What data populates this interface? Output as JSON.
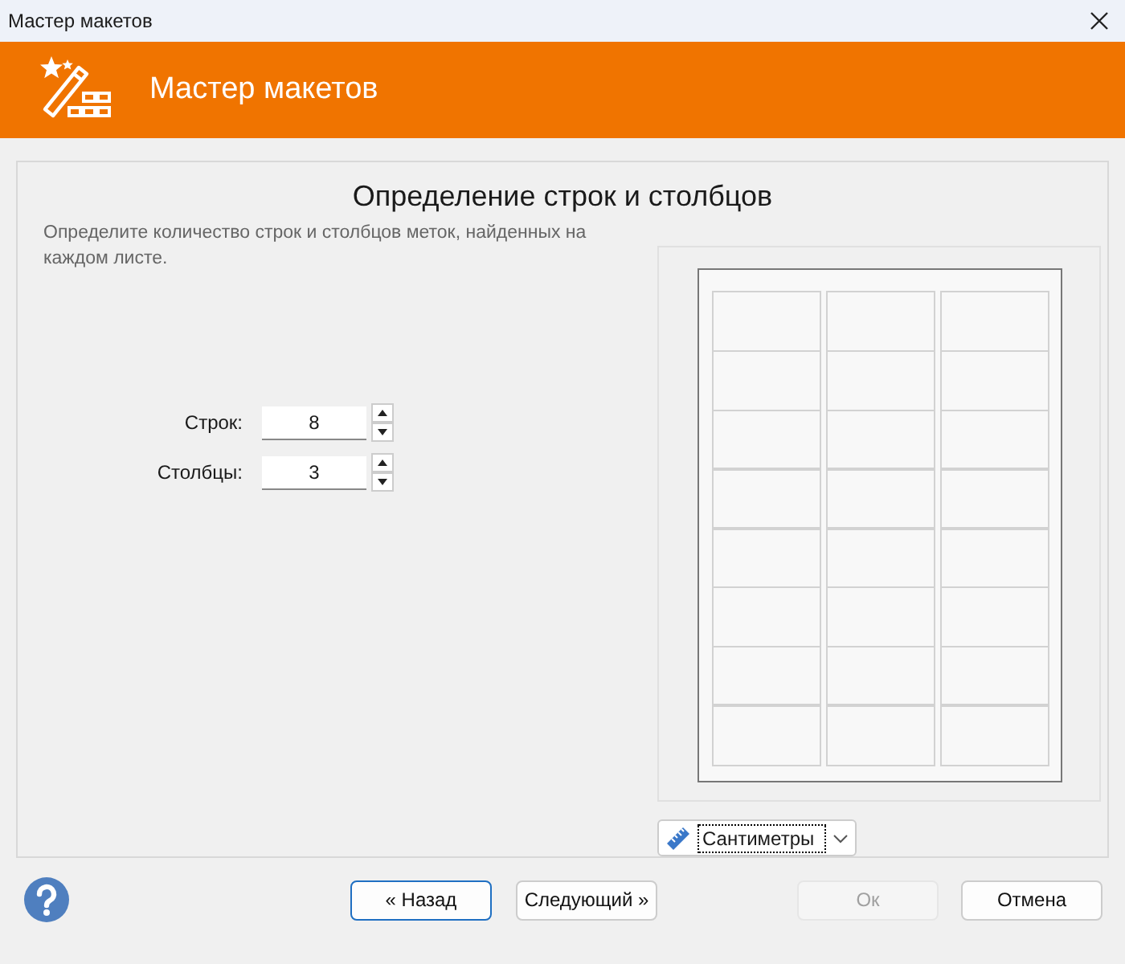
{
  "window": {
    "title": "Мастер макетов"
  },
  "header": {
    "title": "Мастер макетов"
  },
  "page": {
    "heading": "Определение строк и столбцов",
    "description": "Определите количество строк и столбцов меток, найденных на каждом листе."
  },
  "fields": [
    {
      "label": "Строк:",
      "value": "8"
    },
    {
      "label": "Столбцы:",
      "value": "3"
    }
  ],
  "units": {
    "value": "Сантиметры"
  },
  "buttons": [
    {
      "label": "« Назад",
      "kind": "default",
      "disabled": false
    },
    {
      "label": "Следующий »",
      "kind": "normal",
      "disabled": false
    },
    {
      "label": "Ок",
      "kind": "normal",
      "disabled": true
    },
    {
      "label": "Отмена",
      "kind": "normal",
      "disabled": false
    }
  ]
}
